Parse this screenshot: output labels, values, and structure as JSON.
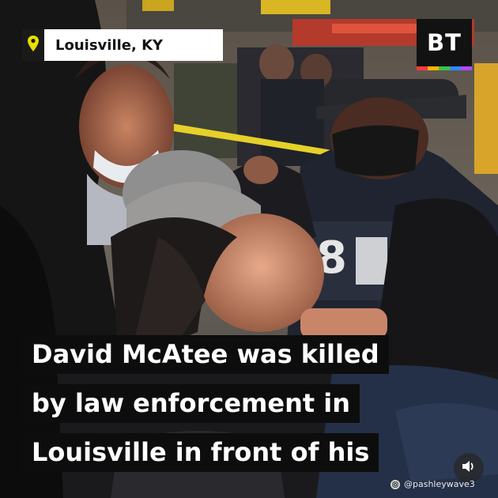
{
  "location": {
    "label": "Louisville, KY",
    "pin_color": "#e8e000",
    "icon": "map-pin-icon"
  },
  "brand": {
    "logo_text": "BT",
    "stripe_colors": [
      "#ff3b3b",
      "#ffb400",
      "#3cc14e",
      "#2d8cff",
      "#b04cff"
    ]
  },
  "caption": {
    "lines": [
      "David McAtee was killed",
      "by law enforcement in",
      "Louisville in front of his"
    ]
  },
  "watermark": {
    "handle": "@pashleywave3",
    "icon": "instagram-icon"
  },
  "controls": {
    "volume_icon": "speaker-icon"
  }
}
